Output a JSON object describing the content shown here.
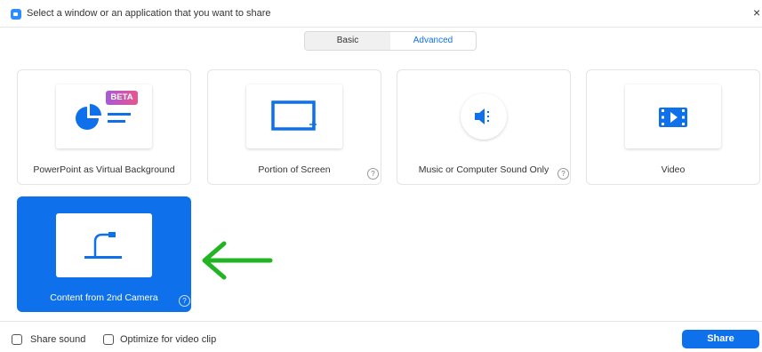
{
  "window": {
    "title": "Select a window or an application that you want to share",
    "close": "×"
  },
  "tabs": [
    {
      "label": "Basic",
      "active": false
    },
    {
      "label": "Advanced",
      "active": true
    }
  ],
  "cards": [
    {
      "label": "PowerPoint as Virtual Background",
      "badge": "BETA",
      "icon": "powerpoint-icon",
      "help": false
    },
    {
      "label": "Portion of Screen",
      "icon": "portion-screen-icon",
      "help": true
    },
    {
      "label": "Music or Computer Sound Only",
      "icon": "speaker-icon",
      "help": true
    },
    {
      "label": "Video",
      "icon": "video-film-icon",
      "help": false
    },
    {
      "label": "Content from 2nd Camera",
      "icon": "document-camera-icon",
      "help": true,
      "selected": true
    }
  ],
  "help_glyph": "?",
  "footer": {
    "share_sound": "Share sound",
    "optimize_video": "Optimize for video clip",
    "share_button": "Share"
  },
  "colors": {
    "accent": "#0e71eb",
    "annotation_arrow": "#22b423"
  }
}
